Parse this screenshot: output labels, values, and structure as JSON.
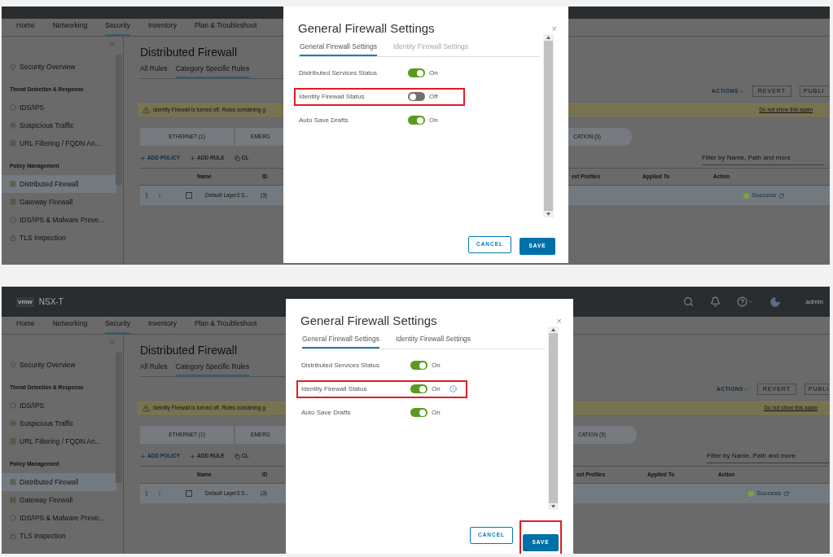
{
  "panels": [
    {
      "nav": [
        {
          "label": "Home",
          "selected": false
        },
        {
          "label": "Networking",
          "selected": false
        },
        {
          "label": "Security",
          "selected": true
        },
        {
          "label": "Inventory",
          "selected": false
        },
        {
          "label": "Plan & Troubleshoot",
          "selected": false
        }
      ],
      "sidebar": [
        {
          "kind": "item",
          "label": "Security Overview",
          "selected": false
        },
        {
          "kind": "heading",
          "label": "Threat Detection & Response"
        },
        {
          "kind": "item",
          "label": "IDS/IPS",
          "selected": false
        },
        {
          "kind": "item",
          "label": "Suspicious Traffic",
          "selected": false
        },
        {
          "kind": "item",
          "label": "URL Filtering / FQDN An...",
          "selected": false
        },
        {
          "kind": "heading",
          "label": "Policy Management"
        },
        {
          "kind": "item",
          "label": "Distributed Firewall",
          "selected": true
        },
        {
          "kind": "item",
          "label": "Gateway Firewall",
          "selected": false
        },
        {
          "kind": "item",
          "label": "IDS/IPS & Malware Preve...",
          "selected": false
        },
        {
          "kind": "item",
          "label": "TLS Inspection",
          "selected": false
        }
      ],
      "page": {
        "title": "Distributed Firewall",
        "tabs": [
          {
            "label": "All Rules",
            "selected": false
          },
          {
            "label": "Category Specific Rules",
            "selected": true
          }
        ],
        "actions": "ACTIONS",
        "revert": "REVERT",
        "publish": "PUBLI",
        "warning": "Identity Firewall is turned off. Rules containing g",
        "warning_link": "Do not show this again",
        "categories": [
          "ETHERNET (1)",
          "EMERG"
        ],
        "categories_right": [
          "CATION (3)"
        ],
        "toolbar": [
          {
            "kind": "add",
            "label": "ADD POLICY"
          },
          {
            "kind": "add",
            "label": "ADD RULE"
          },
          {
            "kind": "copy",
            "label": "CL"
          }
        ],
        "filter_placeholder": "Filter by Name, Path and more",
        "columns": [
          "Name",
          "ID"
        ],
        "columns_right": [
          "ext Profiles",
          "Applied To",
          "Action"
        ],
        "row": {
          "name": "Default Layer3 S...",
          "count": "(3)",
          "status": "Success",
          "checked": false
        }
      },
      "dialog": {
        "title": "General Firewall Settings",
        "close": "×",
        "tabs": [
          {
            "label": "General Firewall Settings",
            "selected": true,
            "disabled": false
          },
          {
            "label": "Identity Firewall Settings",
            "selected": false,
            "disabled": true
          }
        ],
        "settings": [
          {
            "label": "Distributed Services Status",
            "on": true,
            "state": "On",
            "highlighted": false,
            "info": false
          },
          {
            "label": "Identity Firewall Status",
            "on": false,
            "state": "Off",
            "highlighted": true,
            "info": false
          },
          {
            "label": "Auto Save Drafts",
            "on": true,
            "state": "On",
            "highlighted": false,
            "info": false
          }
        ],
        "cancel": {
          "label": "CANCEL"
        },
        "save": {
          "label": "SAVE",
          "highlighted": false
        }
      }
    },
    {
      "header": {
        "logo": "vmw",
        "product": "NSX-T",
        "user": "admin"
      },
      "nav": [
        {
          "label": "Home",
          "selected": false
        },
        {
          "label": "Networking",
          "selected": false
        },
        {
          "label": "Security",
          "selected": true
        },
        {
          "label": "Inventory",
          "selected": false
        },
        {
          "label": "Plan & Troubleshoot",
          "selected": false
        }
      ],
      "sidebar": [
        {
          "kind": "item",
          "label": "Security Overview",
          "selected": false
        },
        {
          "kind": "heading",
          "label": "Threat Detection & Response"
        },
        {
          "kind": "item",
          "label": "IDS/IPS",
          "selected": false
        },
        {
          "kind": "item",
          "label": "Suspicious Traffic",
          "selected": false
        },
        {
          "kind": "item",
          "label": "URL Filtering / FQDN An...",
          "selected": false
        },
        {
          "kind": "heading",
          "label": "Policy Management"
        },
        {
          "kind": "item",
          "label": "Distributed Firewall",
          "selected": true
        },
        {
          "kind": "item",
          "label": "Gateway Firewall",
          "selected": false
        },
        {
          "kind": "item",
          "label": "IDS/IPS & Malware Preve...",
          "selected": false
        },
        {
          "kind": "item",
          "label": "TLS Inspection",
          "selected": false
        }
      ],
      "page": {
        "title": "Distributed Firewall",
        "tabs": [
          {
            "label": "All Rules",
            "selected": false
          },
          {
            "label": "Category Specific Rules",
            "selected": true
          }
        ],
        "actions": "ACTIONS",
        "revert": "REVERT",
        "publish": "PUBLI",
        "warning": "Identity Firewall is turned off. Rules containing g",
        "warning_link": "Do not show this again",
        "categories": [
          "ETHERNET (1)",
          "EMERG"
        ],
        "categories_right": [
          "CATION (3)"
        ],
        "toolbar": [
          {
            "kind": "add",
            "label": "ADD POLICY"
          },
          {
            "kind": "add",
            "label": "ADD RULE"
          },
          {
            "kind": "copy",
            "label": "CL"
          }
        ],
        "filter_placeholder": "Filter by Name, Path and more",
        "columns": [
          "Name",
          "ID"
        ],
        "columns_right": [
          "ext Profiles",
          "Applied To",
          "Action"
        ],
        "row": {
          "name": "Default Layer3 S...",
          "count": "(3)",
          "status": "Success",
          "checked": false
        }
      },
      "dialog": {
        "title": "General Firewall Settings",
        "close": "×",
        "tabs": [
          {
            "label": "General Firewall Settings",
            "selected": true,
            "disabled": false
          },
          {
            "label": "Identity Firewall Settings",
            "selected": false,
            "disabled": false
          }
        ],
        "settings": [
          {
            "label": "Distributed Services Status",
            "on": true,
            "state": "On",
            "highlighted": false,
            "info": false
          },
          {
            "label": "Identity Firewall Status",
            "on": true,
            "state": "On",
            "highlighted": true,
            "info": true
          },
          {
            "label": "Auto Save Drafts",
            "on": true,
            "state": "On",
            "highlighted": false,
            "info": false
          }
        ],
        "cancel": {
          "label": "CANCEL"
        },
        "save": {
          "label": "SAVE",
          "highlighted": true
        }
      }
    }
  ]
}
